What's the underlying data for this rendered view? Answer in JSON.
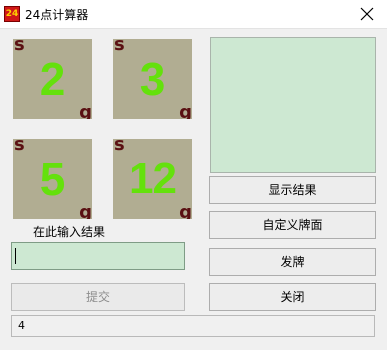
{
  "window": {
    "title": "24点计算器",
    "icon_text": "24"
  },
  "cards": [
    {
      "suit": "s",
      "value": "2",
      "unit": "g"
    },
    {
      "suit": "s",
      "value": "3",
      "unit": "g"
    },
    {
      "suit": "s",
      "value": "5",
      "unit": "g"
    },
    {
      "suit": "s",
      "value": "12",
      "unit": "g"
    }
  ],
  "buttons": {
    "show_result": "显示结果",
    "custom_cards": "自定义牌面",
    "deal": "发牌",
    "close": "关闭",
    "submit": "提交"
  },
  "input": {
    "label": "在此输入结果",
    "value": ""
  },
  "status": {
    "text": "4"
  },
  "colors": {
    "card_bg": "#b1ad92",
    "card_number": "#64e10c",
    "card_corner": "#5a1012",
    "panel_bg": "#cde8d2"
  }
}
